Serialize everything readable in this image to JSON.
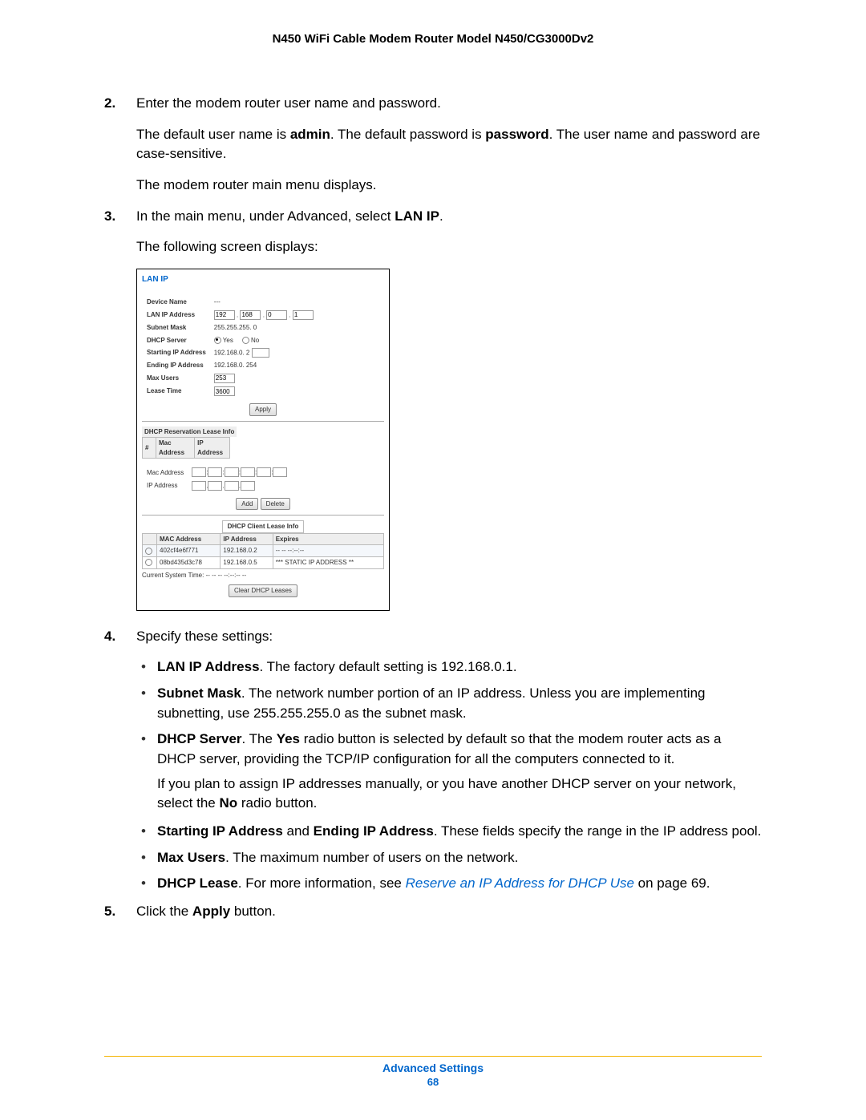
{
  "header": {
    "title": "N450 WiFi Cable Modem Router Model N450/CG3000Dv2"
  },
  "steps": {
    "s2": {
      "num": "2.",
      "line1": "Enter the modem router user name and password.",
      "line2a": "The default user name is ",
      "line2b": "admin",
      "line2c": ". The default password is ",
      "line2d": "password",
      "line2e": ". The user name and password are case-sensitive.",
      "line3": "The modem router main menu displays."
    },
    "s3": {
      "num": "3.",
      "line1a": "In the main menu, under Advanced, select ",
      "line1b": "LAN IP",
      "line1c": ".",
      "line2": "The following screen displays:"
    },
    "s4": {
      "num": "4.",
      "line1": "Specify these settings:"
    },
    "s5": {
      "num": "5.",
      "line1a": "Click the ",
      "line1b": "Apply",
      "line1c": " button."
    }
  },
  "bullets": {
    "b1": {
      "bold": "LAN IP Address",
      "rest": ". The factory default setting is 192.168.0.1."
    },
    "b2": {
      "bold": "Subnet Mask",
      "rest": ". The network number portion of an IP address. Unless you are implementing subnetting, use 255.255.255.0 as the subnet mask."
    },
    "b3": {
      "bold1": "DHCP Server",
      "t1": ". The ",
      "bold2": "Yes",
      "t2": " radio button is selected by default so that the modem router acts as a DHCP server, providing the TCP/IP configuration for all the computers connected to it.",
      "p2a": "If you plan to assign IP addresses manually, or you have another DHCP server on your network, select the ",
      "p2b": "No",
      "p2c": " radio button."
    },
    "b4": {
      "bold1": "Starting IP Address",
      "mid": " and ",
      "bold2": "Ending IP Address",
      "rest": ". These fields specify the range in the IP address pool."
    },
    "b5": {
      "bold": "Max Users",
      "rest": ". The maximum number of users on the network."
    },
    "b6": {
      "bold": "DHCP Lease",
      "t1": ". For more information, see ",
      "link": "Reserve an IP Address for DHCP Use",
      "t2": " on page 69."
    }
  },
  "shot": {
    "title": "LAN IP",
    "rows": {
      "device_name": {
        "label": "Device Name",
        "value": "---"
      },
      "lan_ip": {
        "label": "LAN IP Address",
        "o1": "192",
        "o2": "168",
        "o3": "0",
        "o4": "1"
      },
      "subnet": {
        "label": "Subnet Mask",
        "value": "255.255.255. 0"
      },
      "dhcp": {
        "label": "DHCP Server",
        "yes": "Yes",
        "no": "No"
      },
      "start_ip": {
        "label": "Starting IP Address",
        "value": "192.168.0. 2"
      },
      "end_ip": {
        "label": "Ending IP Address",
        "value": "192.168.0. 254"
      },
      "max_users": {
        "label": "Max Users",
        "value": "253"
      },
      "lease": {
        "label": "Lease Time",
        "value": "3600"
      }
    },
    "apply": "Apply",
    "res_head": "DHCP Reservation Lease Info",
    "res_cols": {
      "c1": "Mac Address",
      "c2": "IP Address"
    },
    "mac_label": "Mac Address",
    "ip_label": "IP Address",
    "add": "Add",
    "delete": "Delete",
    "client_head": "DHCP Client Lease Info",
    "client_cols": {
      "c1": "MAC Address",
      "c2": "IP Address",
      "c3": "Expires"
    },
    "client_rows": [
      {
        "mac": "402cf4e6f771",
        "ip": "192.168.0.2",
        "exp": "-- -- --:--:--"
      },
      {
        "mac": "08bd435d3c78",
        "ip": "192.168.0.5",
        "exp": "*** STATIC IP ADDRESS **"
      }
    ],
    "systime": "Current System Time: -- -- -- --:--:-- --",
    "clear": "Clear DHCP Leases"
  },
  "footer": {
    "section": "Advanced Settings",
    "page": "68"
  }
}
